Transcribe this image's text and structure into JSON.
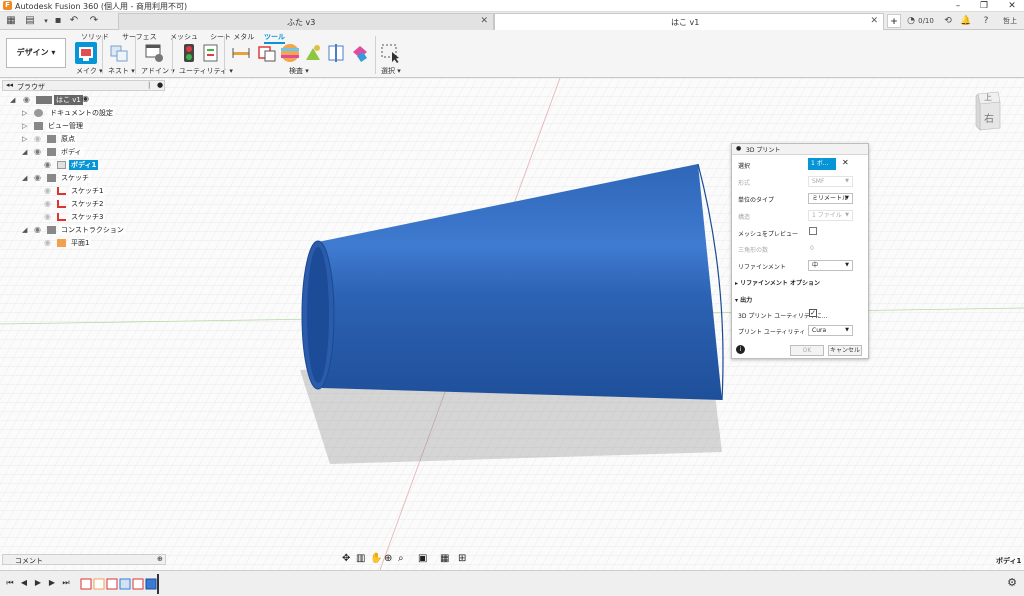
{
  "window": {
    "logo": "F",
    "title": "Autodesk Fusion 360 (個人用 - 商用利用不可)",
    "controls": [
      "–",
      "❐",
      "✕"
    ]
  },
  "tabs": [
    {
      "label": "ふた v3",
      "active": false
    },
    {
      "label": "はこ v1",
      "active": true
    }
  ],
  "tabbar_right": {
    "job_status": "0/10",
    "user": "哲上",
    "plus": "+"
  },
  "ribbon": {
    "workspace": "デザイン ▾",
    "tabs": [
      "ソリッド",
      "サーフェス",
      "メッシュ",
      "シート メタル",
      "ツール"
    ],
    "active_tab": "ツール",
    "groups": [
      "メイク ▾",
      "ネスト ▾",
      "アドイン ▾",
      "ユーティリティ ▾",
      "検査 ▾",
      "選択 ▾"
    ]
  },
  "browser": {
    "title": "ブラウザ",
    "items": [
      {
        "label": "はこ v1",
        "level": 0
      },
      {
        "label": "ドキュメントの設定",
        "level": 1
      },
      {
        "label": "ビュー管理",
        "level": 1
      },
      {
        "label": "原点",
        "level": 1
      },
      {
        "label": "ボディ",
        "level": 1
      },
      {
        "label": "ボディ1",
        "level": 2
      },
      {
        "label": "スケッチ",
        "level": 1
      },
      {
        "label": "スケッチ1",
        "level": 2
      },
      {
        "label": "スケッチ2",
        "level": 2
      },
      {
        "label": "スケッチ3",
        "level": 2
      },
      {
        "label": "コンストラクション",
        "level": 1
      },
      {
        "label": "平面1",
        "level": 2
      }
    ]
  },
  "viewcube": {
    "top": "上",
    "right": "右"
  },
  "dialog": {
    "title": "3D プリント",
    "selection_label": "選択",
    "selection_value": "1 ボ...",
    "format_label": "形式",
    "format_value": "SMF",
    "unit_label": "単位のタイプ",
    "unit_value": "ミリメートル",
    "structure_label": "構造",
    "structure_value": "1 ファイル",
    "preview_label": "メッシュをプレビュー",
    "triangles_label": "三角形の数",
    "triangles_value": "0",
    "refinement_label": "リファインメント",
    "refinement_value": "中",
    "refinement_options": "リファインメント オプション",
    "output_label": "出力",
    "send_label": "3D プリント ユーティリティに...",
    "utility_label": "プリント ユーティリティ",
    "utility_value": "Cura",
    "ok": "OK",
    "cancel": "キャンセル"
  },
  "canvas": {
    "selection_status": "ボディ1"
  },
  "comments": {
    "label": "コメント"
  },
  "colors": {
    "accent": "#0696d7",
    "model": "#2f66b8",
    "ui_bg": "#f5f5f5"
  }
}
